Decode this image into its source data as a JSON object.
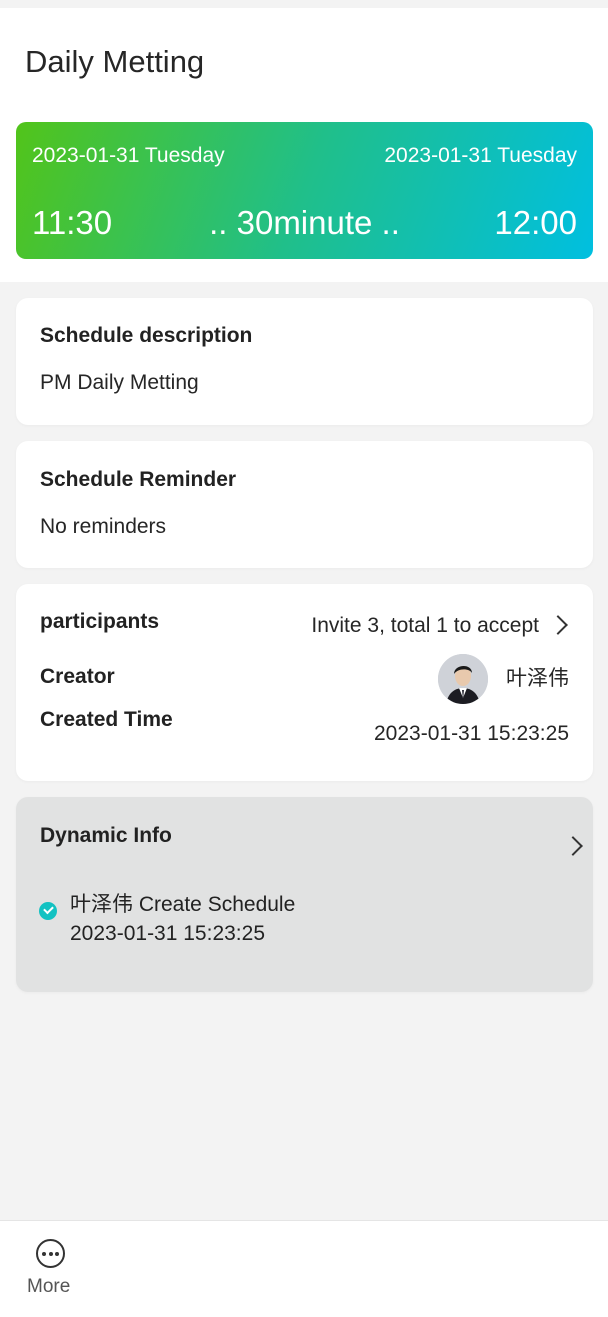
{
  "header": {
    "title": "Daily Metting"
  },
  "time_card": {
    "start_date": "2023-01-31 Tuesday",
    "end_date": "2023-01-31 Tuesday",
    "start_time": "11:30",
    "duration": ".. 30minute ..",
    "end_time": "12:00",
    "gradient_start": "#52c41a",
    "gradient_end": "#00bfe0"
  },
  "description": {
    "title": "Schedule description",
    "text": "PM Daily Metting"
  },
  "reminder": {
    "title": "Schedule Reminder",
    "text": "No reminders"
  },
  "info": {
    "participants_label": "participants",
    "participants_value": "Invite 3, total 1 to accept",
    "creator_label": "Creator",
    "creator_name": "叶泽伟",
    "created_time_label": "Created Time",
    "created_time_value": "2023-01-31 15:23:25"
  },
  "dynamic": {
    "title": "Dynamic Info",
    "entries": [
      {
        "text": "叶泽伟 Create Schedule",
        "time": "2023-01-31 15:23:25"
      }
    ],
    "accent": "#13c2c2"
  },
  "bottom_bar": {
    "more_label": "More",
    "more_icon": "more-circle-icon"
  }
}
